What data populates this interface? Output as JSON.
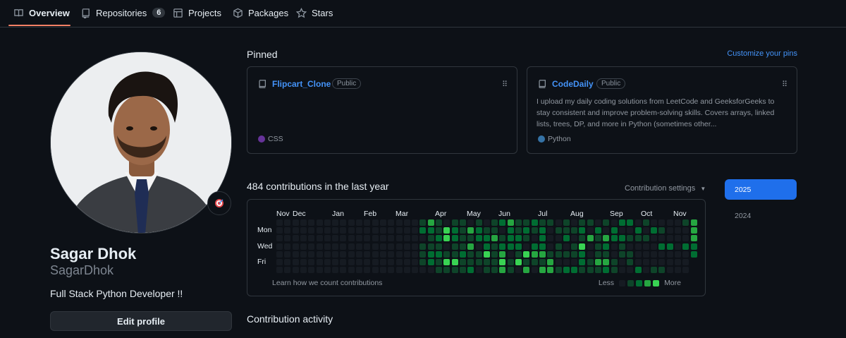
{
  "nav": {
    "tabs": [
      {
        "label": "Overview",
        "icon": "book-icon"
      },
      {
        "label": "Repositories",
        "icon": "repo-icon",
        "count": "6"
      },
      {
        "label": "Projects",
        "icon": "table-icon"
      },
      {
        "label": "Packages",
        "icon": "package-icon"
      },
      {
        "label": "Stars",
        "icon": "star-icon"
      }
    ],
    "active_tab": "Overview"
  },
  "profile": {
    "name": "Sagar Dhok",
    "login": "SagarDhok",
    "bio": "Full Stack Python Developer !!",
    "edit_label": "Edit profile",
    "status_icon": "target-emoji-icon"
  },
  "pinned": {
    "title": "Pinned",
    "customize_label": "Customize your pins",
    "repos": [
      {
        "name": "Flipcart_Clone",
        "visibility": "Public",
        "description": "",
        "language": "CSS",
        "language_color": "#663399"
      },
      {
        "name": "CodeDaily",
        "visibility": "Public",
        "description": "I upload my daily coding solutions from LeetCode and GeeksforGeeks to stay consistent and improve problem-solving skills. Covers arrays, linked lists, trees, DP, and more in Python (sometimes other...",
        "language": "Python",
        "language_color": "#3572A5"
      }
    ]
  },
  "contributions": {
    "title": "484 contributions in the last year",
    "settings_label": "Contribution settings",
    "months": [
      "Nov",
      "Dec",
      "Jan",
      "Feb",
      "Mar",
      "Apr",
      "May",
      "Jun",
      "Jul",
      "Aug",
      "Sep",
      "Oct",
      "Nov"
    ],
    "days": [
      "Mon",
      "Wed",
      "Fri"
    ],
    "learn_label": "Learn how we count contributions",
    "legend_less": "Less",
    "legend_more": "More",
    "level_colors": [
      "#161b22",
      "#0e4429",
      "#006d32",
      "#26a641",
      "#39d353"
    ]
  },
  "years": {
    "selected": "2025",
    "other": "2024"
  },
  "activity": {
    "title": "Contribution activity"
  }
}
